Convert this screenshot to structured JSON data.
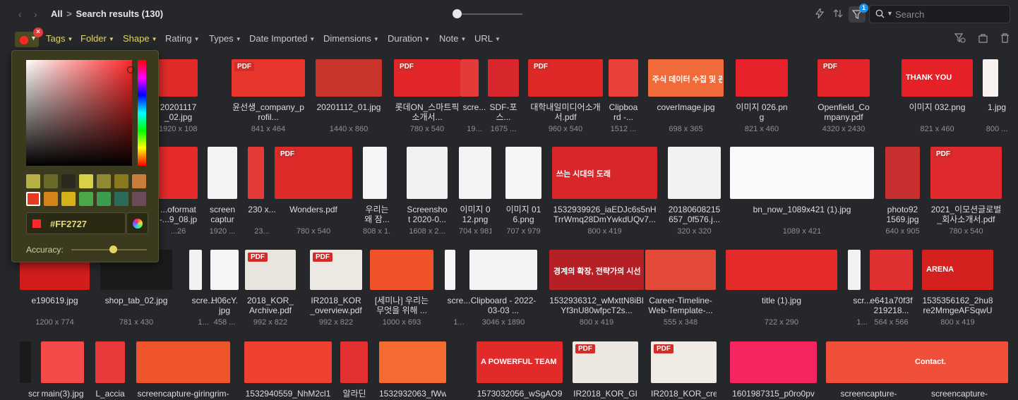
{
  "breadcrumb": {
    "root": "All",
    "separator": ">",
    "current": "Search results (130)"
  },
  "toolbar": {
    "filter_count": "1"
  },
  "search": {
    "placeholder": "Search",
    "value": ""
  },
  "filters": [
    "Tags",
    "Folder",
    "Shape",
    "Rating",
    "Types",
    "Date Imported",
    "Dimensions",
    "Duration",
    "Note",
    "URL"
  ],
  "color_filter": {
    "selected_color": "#FF2727",
    "hex_label": "#FF2727",
    "accuracy_label": "Accuracy:",
    "accuracy_value": 0.55,
    "swatches": [
      "#b7b046",
      "#6b6a2a",
      "#2a2a20",
      "#d9d04a",
      "#8f8a33",
      "#8a7a1e",
      "#c97d3b",
      "#e83a1e",
      "#d4821a",
      "#d6b21a",
      "#4aa84a",
      "#3d9c4e",
      "#2e6a5a",
      "#6b4a5a"
    ]
  },
  "grid": {
    "row1": [
      {
        "name": "20201117_02.jpg",
        "dims": "1920 x 1080",
        "color": "#e12a2a"
      },
      {
        "name": "윤선생_company_profil...",
        "dims": "841 x 464",
        "color": "#e8362c",
        "pdf": "PDF"
      },
      {
        "name": "20201112_01.jpg",
        "dims": "1440 x 860",
        "color": "#c9352b"
      },
      {
        "name": "롯데ON_스마트픽소개서...",
        "dims": "780 x 540",
        "color": "#e2262a",
        "pdf": "PDF"
      },
      {
        "name": "scre...",
        "dims": "19...",
        "color": "#e33a3a"
      },
      {
        "name": "SDF-포스...",
        "dims": "1675 ...",
        "color": "#d9272e"
      },
      {
        "name": "대학내일미디어소개서.pdf",
        "dims": "960 x 540",
        "color": "#e02828",
        "pdf": "PDF"
      },
      {
        "name": "Clipboard -...",
        "dims": "1512 ...",
        "color": "#e8403a"
      },
      {
        "name": "coverImage.jpg",
        "dims": "698 x 365",
        "color": "#f06a3a",
        "inner": "주식 데이터 수집 및 관리 With R"
      },
      {
        "name": "이미지 026.png",
        "dims": "821 x 460",
        "color": "#e8222a"
      },
      {
        "name": "Openfield_Company.pdf",
        "dims": "4320 x 2430",
        "color": "#e4262a",
        "pdf": "PDF"
      },
      {
        "name": "이미지 032.png",
        "dims": "821 x 460",
        "color": "#e52026",
        "inner": "THANK YOU"
      },
      {
        "name": "1.jpg",
        "dims": "800 ...",
        "color": "#f7f2ef"
      }
    ],
    "row2": [
      {
        "name": "...oformat-...9_08.jpg",
        "dims": "...26",
        "color": "#e52b2b"
      },
      {
        "name": "screen capture...",
        "dims": "1920 ...",
        "color": "#f3f3f3"
      },
      {
        "name": "230 x...",
        "dims": "23...",
        "color": "#e63a3a"
      },
      {
        "name": "Wonders.pdf",
        "dims": "780 x 540",
        "color": "#df2a2a",
        "pdf": "PDF"
      },
      {
        "name": "우리는 왜 잠...",
        "dims": "808 x 1...",
        "color": "#f5f5f5"
      },
      {
        "name": "Screenshot 2020-0...",
        "dims": "1608 x 2...",
        "color": "#f1f1f1"
      },
      {
        "name": "이미지 012.png",
        "dims": "704 x 981",
        "color": "#f4f4f4"
      },
      {
        "name": "이미지 016.png",
        "dims": "707 x 979",
        "color": "#f6f6f6"
      },
      {
        "name": "1532939926_iaEDJc6s5nHTrrWmq28DmYwkdUQv7...",
        "dims": "800 x 419",
        "color": "#d8262a",
        "inner": "쓰는 시대의 도래"
      },
      {
        "name": "20180608215657_0f576.j...",
        "dims": "320 x 320",
        "color": "#f2f2f2"
      },
      {
        "name": "bn_now_1089x421 (1).jpg",
        "dims": "1089 x 421",
        "color": "#fafafa"
      },
      {
        "name": "photo921569.jpg",
        "dims": "640 x 905",
        "color": "#c83030"
      },
      {
        "name": "2021_이모션글로벌_회사소개서.pdf",
        "dims": "780 x 540",
        "color": "#e12a2f",
        "pdf": "PDF"
      }
    ],
    "row3": [
      {
        "name": "e190619.jpg",
        "dims": "1200 x 774",
        "color": "#d21d1d"
      },
      {
        "name": "shop_tab_02.jpg",
        "dims": "781 x 430",
        "color": "#1b1b1b"
      },
      {
        "name": "scre...",
        "dims": "1...",
        "color": "#f2f2f2"
      },
      {
        "name": "H06cY.jpg",
        "dims": "458 ...",
        "color": "#f6f6f6"
      },
      {
        "name": "2018_KOR_Archive.pdf",
        "dims": "992 x 822",
        "color": "#e8e4de",
        "pdf": "PDF"
      },
      {
        "name": "IR2018_KOR_overview.pdf",
        "dims": "992 x 822",
        "color": "#ece8e2",
        "pdf": "PDF"
      },
      {
        "name": "[세미나] 우리는 무엇을 위해 ...",
        "dims": "1000 x 693",
        "color": "#f0522a"
      },
      {
        "name": "scre...",
        "dims": "1...",
        "color": "#f5f5f5"
      },
      {
        "name": "Clipboard - 2022-03-03 ...",
        "dims": "3046 x 1890",
        "color": "#f4f4f4"
      },
      {
        "name": "1532936312_wMxttN8iBlYf3nU80wfpcT2s...",
        "dims": "800 x 419",
        "color": "#b51f26",
        "inner": "경계의 확장, 전략가의 시선"
      },
      {
        "name": "Career-Timeline-Web-Template-...",
        "dims": "555 x 348",
        "color": "#e34a3a"
      },
      {
        "name": "title (1).jpg",
        "dims": "722 x 290",
        "color": "#e52a2a"
      },
      {
        "name": "scr...",
        "dims": "1...",
        "color": "#f2f2f2"
      },
      {
        "name": "e641a70f3f219218...",
        "dims": "564 x 566",
        "color": "#e03030"
      },
      {
        "name": "1535356162_2hu8re2MmgeAFSqwU2O...",
        "dims": "800 x 419",
        "color": "#d52020",
        "inner": "ARENA"
      }
    ],
    "row4": [
      {
        "name": "scr",
        "color": "#1a1a1a"
      },
      {
        "name": "main(3).jpg",
        "color": "#f34a4a"
      },
      {
        "name": "L_accia",
        "color": "#e83a3a"
      },
      {
        "name": "screencapture-giringrim-",
        "color": "#f0542a"
      },
      {
        "name": "1532940559_NhM2cl1",
        "color": "#f04030"
      },
      {
        "name": "알라딘",
        "color": "#e33030"
      },
      {
        "name": "1532932063_fWwFIPz",
        "color": "#f56a30"
      },
      {
        "name": "1573032056_wSgAO9",
        "color": "#e32a2a",
        "inner": "A POWERFUL TEAM"
      },
      {
        "name": "IR2018_KOR_GI",
        "color": "#ece7e0",
        "pdf": "PDF"
      },
      {
        "name": "IR2018_KOR_cre",
        "color": "#f0ebe5",
        "pdf": "PDF"
      },
      {
        "name": "1601987315_p0ro0pv",
        "color": "#f52560"
      },
      {
        "name": "screencapture-",
        "color": "#f0503a"
      },
      {
        "name": "screencapture-",
        "color": "#f0503a",
        "inner": "Contact."
      }
    ]
  }
}
